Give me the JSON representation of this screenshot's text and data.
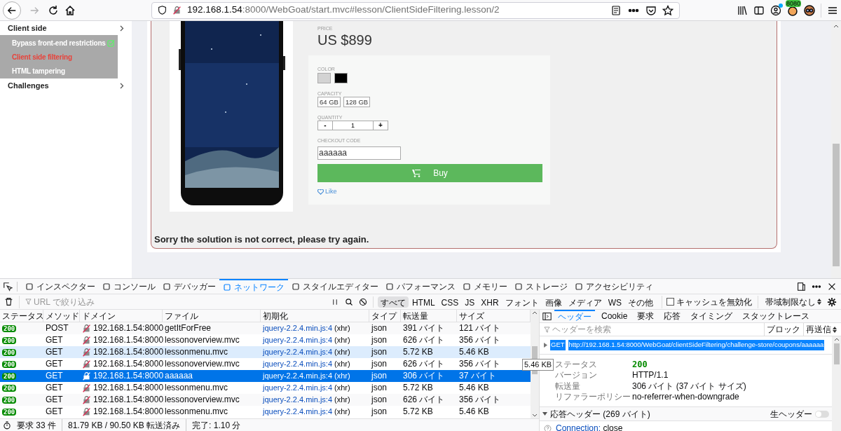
{
  "browser": {
    "forward_disabled": true,
    "address": {
      "host": "192.168.1.54",
      "rest": ":8000/WebGoat/start.mvc#lesson/ClientSideFiltering.lesson/2"
    },
    "extension_badge": "8080"
  },
  "sidebar": {
    "groups": [
      {
        "label": "Client side",
        "children": [
          {
            "label": "Bypass front-end restrictions",
            "completed": true,
            "selected": false
          },
          {
            "label": "Client side filtering",
            "completed": false,
            "selected": true
          },
          {
            "label": "HTML tampering",
            "completed": false,
            "selected": false
          }
        ]
      },
      {
        "label": "Challenges"
      }
    ]
  },
  "product": {
    "price_label": "PRICE",
    "price": "US $899",
    "color_label": "COLOR",
    "colors": [
      {
        "color": "#d3d3d3"
      },
      {
        "color": "#000000"
      }
    ],
    "capacity_label": "CAPACITY",
    "capacities": [
      "64 GB",
      "128 GB"
    ],
    "quantity_label": "QUANTITY",
    "quantity": {
      "minus": "-",
      "value": "1",
      "plus": "+"
    },
    "checkout_label": "CHECKOUT CODE",
    "checkout_value": "aaaaaa",
    "buy": "Buy",
    "like": "Like"
  },
  "message": "Sorry the solution is not correct, please try again.",
  "devtools": {
    "tabs": [
      {
        "label": "インスペクター",
        "selected": false
      },
      {
        "label": "コンソール",
        "selected": false
      },
      {
        "label": "デバッガー",
        "selected": false
      },
      {
        "label": "ネットワーク",
        "selected": true
      },
      {
        "label": "スタイルエディター",
        "selected": false
      },
      {
        "label": "パフォーマンス",
        "selected": false
      },
      {
        "label": "メモリー",
        "selected": false
      },
      {
        "label": "ストレージ",
        "selected": false
      },
      {
        "label": "アクセシビリティ",
        "selected": false
      }
    ],
    "filter_placeholder": "URL で絞り込み",
    "type_filters": [
      {
        "label": "すべて",
        "selected": true
      },
      {
        "label": "HTML",
        "selected": false
      },
      {
        "label": "CSS",
        "selected": false
      },
      {
        "label": "JS",
        "selected": false
      },
      {
        "label": "XHR",
        "selected": false
      },
      {
        "label": "フォント",
        "selected": false
      },
      {
        "label": "画像",
        "selected": false
      },
      {
        "label": "メディア",
        "selected": false
      },
      {
        "label": "WS",
        "selected": false
      },
      {
        "label": "その他",
        "selected": false
      }
    ],
    "disable_cache": {
      "label": "キャッシュを無効化",
      "checked": false
    },
    "throttling": "帯域制限なし",
    "columns": [
      "ステータス",
      "メソッド",
      "ドメイン",
      "ファイル",
      "初期化",
      "タイプ",
      "転送量",
      "サイズ"
    ],
    "rows": [
      {
        "status": "200",
        "method": "POST",
        "domain": "192.168.1.54:8000",
        "file": "getItForFree",
        "initiator": "jquery-2.2.4.min.js:4",
        "cause": "(xhr)",
        "type": "json",
        "transferred": "391 バイト",
        "size": "121 バイト",
        "selected": false,
        "hovered": false
      },
      {
        "status": "200",
        "method": "GET",
        "domain": "192.168.1.54:8000",
        "file": "lessonoverview.mvc",
        "initiator": "jquery-2.2.4.min.js:4",
        "cause": "(xhr)",
        "type": "json",
        "transferred": "626 バイト",
        "size": "356 バイト",
        "selected": false,
        "hovered": false
      },
      {
        "status": "200",
        "method": "GET",
        "domain": "192.168.1.54:8000",
        "file": "lessonmenu.mvc",
        "initiator": "jquery-2.2.4.min.js:4",
        "cause": "(xhr)",
        "type": "json",
        "transferred": "5.72 KB",
        "size": "5.46 KB",
        "selected": false,
        "hovered": true
      },
      {
        "status": "200",
        "method": "GET",
        "domain": "192.168.1.54:8000",
        "file": "lessonoverview.mvc",
        "initiator": "jquery-2.2.4.min.js:4",
        "cause": "(xhr)",
        "type": "json",
        "transferred": "626 バイト",
        "size": "356 バイト",
        "selected": false,
        "hovered": false
      },
      {
        "status": "200",
        "method": "GET",
        "domain": "192.168.1.54:8000",
        "file": "aaaaaa",
        "initiator": "jquery-2.2.4.min.js:4",
        "cause": "(xhr)",
        "type": "json",
        "transferred": "306 バイト",
        "size": "37 バイト",
        "selected": true,
        "hovered": false
      },
      {
        "status": "200",
        "method": "GET",
        "domain": "192.168.1.54:8000",
        "file": "lessonmenu.mvc",
        "initiator": "jquery-2.2.4.min.js:4",
        "cause": "(xhr)",
        "type": "json",
        "transferred": "5.72 KB",
        "size": "5.46 KB",
        "selected": false,
        "hovered": false
      },
      {
        "status": "200",
        "method": "GET",
        "domain": "192.168.1.54:8000",
        "file": "lessonoverview.mvc",
        "initiator": "jquery-2.2.4.min.js:4",
        "cause": "(xhr)",
        "type": "json",
        "transferred": "626 バイト",
        "size": "356 バイト",
        "selected": false,
        "hovered": false
      },
      {
        "status": "200",
        "method": "GET",
        "domain": "192.168.1.54:8000",
        "file": "lessonmenu.mvc",
        "initiator": "jquery-2.2.4.min.js:4",
        "cause": "(xhr)",
        "type": "json",
        "transferred": "5.72 KB",
        "size": "5.46 KB",
        "selected": false,
        "hovered": false
      }
    ],
    "tooltip": "5.46 KB",
    "status_bar": {
      "requests": "要求 33 件",
      "transferred": "81.79 KB / 90.50 KB 転送済み",
      "finished": "完了: 1.10 分"
    },
    "details": {
      "tabs": [
        {
          "label": "ヘッダー",
          "selected": true
        },
        {
          "label": "Cookie",
          "selected": false
        },
        {
          "label": "要求",
          "selected": false
        },
        {
          "label": "応答",
          "selected": false
        },
        {
          "label": "タイミング",
          "selected": false
        },
        {
          "label": "スタックトレース",
          "selected": false
        }
      ],
      "filter_placeholder": "ヘッダーを検索",
      "block": "ブロック",
      "resend": "再送信",
      "request": {
        "method": "GET",
        "url": "http://192.168.1.54:8000/WebGoat/clientSideFiltering/challenge-store/coupons/aaaaaa"
      },
      "fields": [
        {
          "label": "ステータス",
          "value": "200",
          "kind": "status"
        },
        {
          "label": "バージョン",
          "value": "HTTP/1.1",
          "kind": "text"
        },
        {
          "label": "転送量",
          "value": "306 バイト (37 バイト サイズ)",
          "kind": "text"
        },
        {
          "label": "リファラーポリシー",
          "value": "no-referrer-when-downgrade",
          "kind": "text"
        }
      ],
      "response_headers": {
        "title": "応答ヘッダー (269 バイト)",
        "raw_label": "生ヘッダー",
        "raw_on": false
      },
      "headers": [
        {
          "name": "Connection:",
          "value": "close"
        }
      ]
    }
  }
}
